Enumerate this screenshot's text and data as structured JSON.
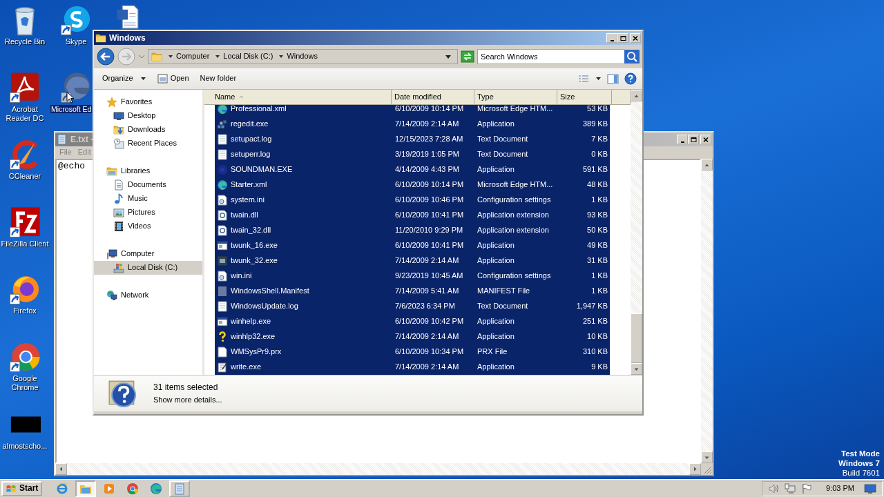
{
  "desktop": {
    "columns": [
      [
        {
          "kind": "recycle-bin",
          "label": "Recycle Bin",
          "selected": false
        },
        {
          "kind": "acrobat",
          "label": "Acrobat Reader DC",
          "selected": false
        },
        {
          "kind": "ccleaner",
          "label": "CCleaner",
          "selected": false
        },
        {
          "kind": "filezilla",
          "label": "FileZilla Client",
          "selected": false
        },
        {
          "kind": "firefox",
          "label": "Firefox",
          "selected": false
        },
        {
          "kind": "chrome",
          "label": "Google Chrome",
          "selected": false
        },
        {
          "kind": "black-file",
          "label": "almostscho...",
          "selected": false
        }
      ],
      [
        {
          "kind": "skype",
          "label": "Skype",
          "selected": false
        },
        {
          "kind": "edge",
          "label": "Microsoft Ed",
          "selected": true
        }
      ],
      [
        {
          "kind": "word"
        }
      ]
    ]
  },
  "notepad": {
    "title": "E.txt -",
    "menu": [
      "File",
      "Edit"
    ],
    "text": "@echo"
  },
  "explorer": {
    "title": "Windows",
    "breadcrumbs": [
      "Computer",
      "Local Disk (C:)",
      "Windows"
    ],
    "search": {
      "placeholder": "Search Windows"
    },
    "toolbar": [
      {
        "label": "Organize",
        "kind": "menu"
      },
      {
        "label": "Open",
        "kind": "open"
      },
      {
        "label": "New folder",
        "kind": "plain"
      }
    ],
    "nav": [
      {
        "label": "Favorites",
        "kind": "star",
        "selected": false,
        "children": [
          {
            "label": "Desktop",
            "kind": "desktop",
            "selected": false
          },
          {
            "label": "Downloads",
            "kind": "downloads",
            "selected": false
          },
          {
            "label": "Recent Places",
            "kind": "recent",
            "selected": false
          }
        ]
      },
      {
        "label": "Libraries",
        "kind": "library",
        "selected": false,
        "children": [
          {
            "label": "Documents",
            "kind": "documents",
            "selected": false
          },
          {
            "label": "Music",
            "kind": "music",
            "selected": false
          },
          {
            "label": "Pictures",
            "kind": "pictures",
            "selected": false
          },
          {
            "label": "Videos",
            "kind": "videos",
            "selected": false
          }
        ]
      },
      {
        "label": "Computer",
        "kind": "computer",
        "selected": false,
        "children": [
          {
            "label": "Local Disk (C:)",
            "kind": "drive",
            "selected": true
          }
        ]
      },
      {
        "label": "Network",
        "kind": "network",
        "selected": false
      }
    ],
    "columns": [
      "Name",
      "Date modified",
      "Type",
      "Size"
    ],
    "rows": [
      {
        "kind": "edge",
        "name": "Professional.xml",
        "date": "6/10/2009 10:14 PM",
        "type": "Microsoft Edge HTM...",
        "size": "53 KB",
        "selected": true
      },
      {
        "kind": "regedit",
        "name": "regedit.exe",
        "date": "7/14/2009 2:14 AM",
        "type": "Application",
        "size": "389 KB",
        "selected": true
      },
      {
        "kind": "text",
        "name": "setupact.log",
        "date": "12/15/2023 7:28 AM",
        "type": "Text Document",
        "size": "7 KB",
        "selected": true
      },
      {
        "kind": "text",
        "name": "setuperr.log",
        "date": "3/19/2019 1:05 PM",
        "type": "Text Document",
        "size": "0 KB",
        "selected": true
      },
      {
        "kind": "sound",
        "name": "SOUNDMAN.EXE",
        "date": "4/14/2009 4:43 PM",
        "type": "Application",
        "size": "591 KB",
        "selected": true
      },
      {
        "kind": "edge",
        "name": "Starter.xml",
        "date": "6/10/2009 10:14 PM",
        "type": "Microsoft Edge HTM...",
        "size": "48 KB",
        "selected": true
      },
      {
        "kind": "ini",
        "name": "system.ini",
        "date": "6/10/2009 10:46 PM",
        "type": "Configuration settings",
        "size": "1 KB",
        "selected": true
      },
      {
        "kind": "dll",
        "name": "twain.dll",
        "date": "6/10/2009 10:41 PM",
        "type": "Application extension",
        "size": "93 KB",
        "selected": true
      },
      {
        "kind": "dll",
        "name": "twain_32.dll",
        "date": "11/20/2010 9:29 PM",
        "type": "Application extension",
        "size": "50 KB",
        "selected": true
      },
      {
        "kind": "window",
        "name": "twunk_16.exe",
        "date": "6/10/2009 10:41 PM",
        "type": "Application",
        "size": "49 KB",
        "selected": true
      },
      {
        "kind": "scanner",
        "name": "twunk_32.exe",
        "date": "7/14/2009 2:14 AM",
        "type": "Application",
        "size": "31 KB",
        "selected": true
      },
      {
        "kind": "ini",
        "name": "win.ini",
        "date": "9/23/2019 10:45 AM",
        "type": "Configuration settings",
        "size": "1 KB",
        "selected": true
      },
      {
        "kind": "manifest",
        "name": "WindowsShell.Manifest",
        "date": "7/14/2009 5:41 AM",
        "type": "MANIFEST File",
        "size": "1 KB",
        "selected": true
      },
      {
        "kind": "text",
        "name": "WindowsUpdate.log",
        "date": "7/6/2023 6:34 PM",
        "type": "Text Document",
        "size": "1,947 KB",
        "selected": true
      },
      {
        "kind": "window",
        "name": "winhelp.exe",
        "date": "6/10/2009 10:42 PM",
        "type": "Application",
        "size": "251 KB",
        "selected": true
      },
      {
        "kind": "help",
        "name": "winhlp32.exe",
        "date": "7/14/2009 2:14 AM",
        "type": "Application",
        "size": "10 KB",
        "selected": true
      },
      {
        "kind": "blank",
        "name": "WMSysPr9.prx",
        "date": "6/10/2009 10:34 PM",
        "type": "PRX File",
        "size": "310 KB",
        "selected": true
      },
      {
        "kind": "write",
        "name": "write.exe",
        "date": "7/14/2009 2:14 AM",
        "type": "Application",
        "size": "9 KB",
        "selected": true
      }
    ],
    "details": {
      "summary": "31 items selected",
      "link": "Show more details..."
    }
  },
  "taskbar": {
    "start": "Start",
    "items": [
      {
        "kind": "ie",
        "running": false,
        "selected": false
      },
      {
        "kind": "explorer",
        "running": true,
        "selected": true
      },
      {
        "kind": "media",
        "running": false,
        "selected": false
      },
      {
        "kind": "chrome",
        "running": false,
        "selected": false
      },
      {
        "kind": "edge",
        "running": false,
        "selected": false
      },
      {
        "kind": "notepad",
        "running": true,
        "selected": false
      }
    ],
    "clock": "9:03 PM"
  },
  "os_notice": [
    "Test Mode",
    "Windows 7",
    "Build 7601"
  ]
}
